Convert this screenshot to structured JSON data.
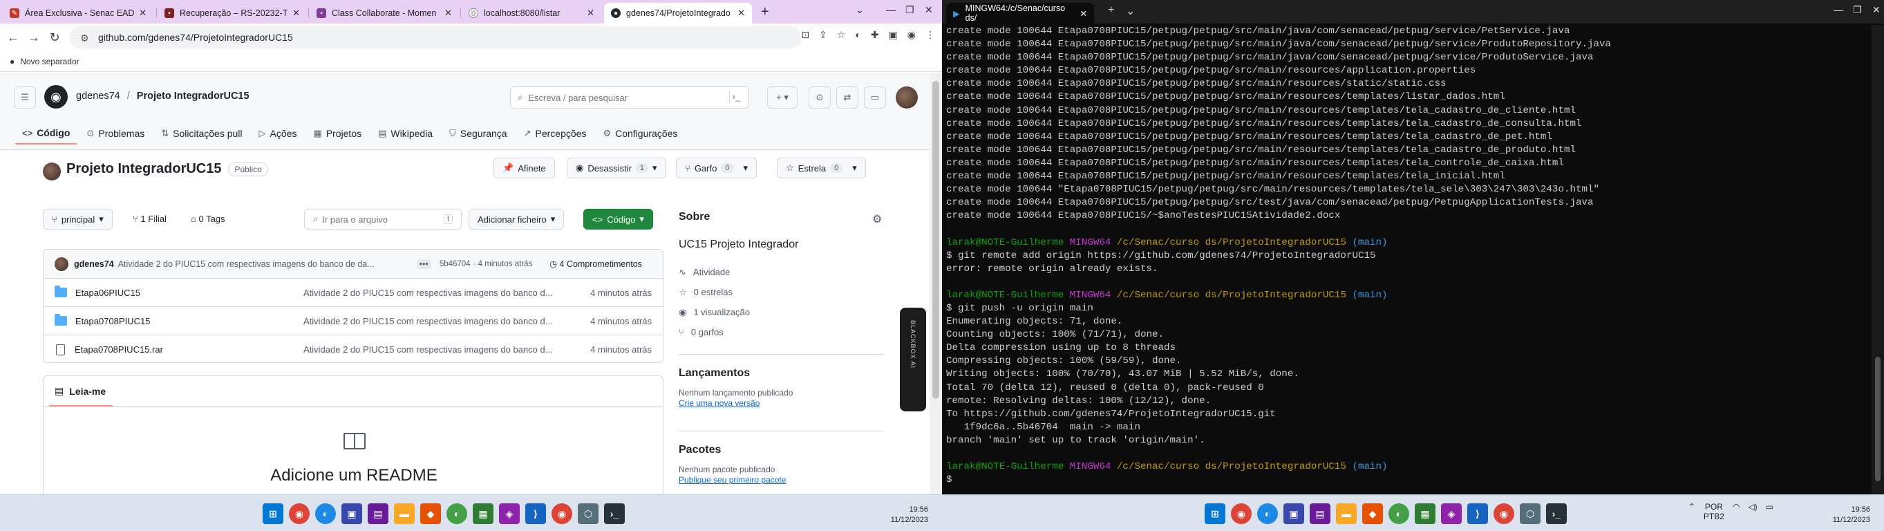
{
  "browser": {
    "tabs": [
      {
        "title": "Área Exclusiva - Senac EAD",
        "color": "#c0392b"
      },
      {
        "title": "Recuperação – RS-20232-TE",
        "color": "#7b1f1f"
      },
      {
        "title": "Class Collaborate - Momen",
        "color": "#7d3c98"
      },
      {
        "title": "localhost:8080/listar",
        "color": "#666666"
      },
      {
        "title": "gdenes74/ProjetoIntegrado",
        "color": "#24292f"
      }
    ],
    "url": "github.com/gdenes74/ProjetoIntegradorUC15",
    "bookmark": "Novo separador"
  },
  "github": {
    "owner": "gdenes74",
    "repo": "Projeto IntegradorUC15",
    "search_placeholder": "Escreva / para pesquisar",
    "nav": [
      "Código",
      "Problemas",
      "Solicitações pull",
      "Ações",
      "Projetos",
      "Wikipedia",
      "Segurança",
      "Percepções",
      "Configurações"
    ],
    "repo_title": "Projeto IntegradorUC15",
    "visibility": "Público",
    "pin": "Afinete",
    "unwatch": "Desassistir",
    "unwatch_count": "1",
    "fork": "Garfo",
    "fork_count": "0",
    "star": "Estrela",
    "star_count": "0",
    "branch": "principal",
    "branches": "1 Filial",
    "tags": "0 Tags",
    "goto_file": "Ir para o arquivo",
    "goto_key": "t",
    "add_file": "Adicionar ficheiro",
    "code_btn": "Código",
    "commit": {
      "author": "gdenes74",
      "message": "Atividade 2 do PIUC15 com respectivas imagens do banco de da...",
      "hash": "5b46704",
      "time": "· 4 minutos atrás",
      "commits": "4 Comprometimentos"
    },
    "files": [
      {
        "name": "Etapa06PIUC15",
        "type": "folder",
        "msg": "Atividade 2 do PIUC15 com respectivas imagens do banco d...",
        "time": "4 minutos atrás"
      },
      {
        "name": "Etapa0708PIUC15",
        "type": "folder",
        "msg": "Atividade 2 do PIUC15 com respectivas imagens do banco d...",
        "time": "4 minutos atrás"
      },
      {
        "name": "Etapa0708PIUC15.rar",
        "type": "file",
        "msg": "Atividade 2 do PIUC15 com respectivas imagens do banco d...",
        "time": "4 minutos atrás"
      }
    ],
    "readme_tab": "Leia-me",
    "readme_cta": "Adicione um README",
    "about": {
      "title": "Sobre",
      "desc": "UC15 Projeto Integrador",
      "stats": [
        "Atividade",
        "0 estrelas",
        "1 visualização",
        "0 garfos"
      ]
    },
    "releases": {
      "title": "Lançamentos",
      "text": "Nenhum lançamento publicado",
      "link": "Crie uma nova versão"
    },
    "packages": {
      "title": "Pacotes",
      "text": "Nenhum pacote publicado",
      "link": "Publique seu primeiro pacote"
    },
    "blackbox": "BLACKBOX AI"
  },
  "taskbar_left": {
    "time": "19:56",
    "date": "11/12/2023"
  },
  "taskbar_right": {
    "lang1": "POR",
    "lang2": "PTB2",
    "time": "19:56",
    "date": "11/12/2023"
  },
  "terminal": {
    "title": "MINGW64:/c/Senac/curso ds/",
    "create_lines": [
      "create mode 100644 Etapa0708PIUC15/petpug/petpug/src/main/java/com/senacead/petpug/service/PetService.java",
      "create mode 100644 Etapa0708PIUC15/petpug/petpug/src/main/java/com/senacead/petpug/service/ProdutoRepository.java",
      "create mode 100644 Etapa0708PIUC15/petpug/petpug/src/main/java/com/senacead/petpug/service/ProdutoService.java",
      "create mode 100644 Etapa0708PIUC15/petpug/petpug/src/main/resources/application.properties",
      "create mode 100644 Etapa0708PIUC15/petpug/petpug/src/main/resources/static/static.css",
      "create mode 100644 Etapa0708PIUC15/petpug/petpug/src/main/resources/templates/listar_dados.html",
      "create mode 100644 Etapa0708PIUC15/petpug/petpug/src/main/resources/templates/tela_cadastro_de_cliente.html",
      "create mode 100644 Etapa0708PIUC15/petpug/petpug/src/main/resources/templates/tela_cadastro_de_consulta.html",
      "create mode 100644 Etapa0708PIUC15/petpug/petpug/src/main/resources/templates/tela_cadastro_de_pet.html",
      "create mode 100644 Etapa0708PIUC15/petpug/petpug/src/main/resources/templates/tela_cadastro_de_produto.html",
      "create mode 100644 Etapa0708PIUC15/petpug/petpug/src/main/resources/templates/tela_controle_de_caixa.html",
      "create mode 100644 Etapa0708PIUC15/petpug/petpug/src/main/resources/templates/tela_inicial.html",
      "create mode 100644 \"Etapa0708PIUC15/petpug/petpug/src/main/resources/templates/tela_sele\\303\\247\\303\\243o.html\"",
      "create mode 100644 Etapa0708PIUC15/petpug/petpug/src/test/java/com/senacead/petpug/PetpugApplicationTests.java",
      "create mode 100644 Etapa0708PIUC15/~$anoTestesPIUC15Atividade2.docx"
    ],
    "prompt_user": "larak@NOTE-Guilherme",
    "prompt_env": "MINGW64",
    "prompt_path": "/c/Senac/curso ds/ProjetoIntegradorUC15",
    "prompt_branch": "(main)",
    "cmd1": "$ git remote add origin https://github.com/gdenes74/ProjetoIntegradorUC15",
    "out1": [
      "error: remote origin already exists."
    ],
    "cmd2": "$ git push -u origin main",
    "out2": [
      "Enumerating objects: 71, done.",
      "Counting objects: 100% (71/71), done.",
      "Delta compression using up to 8 threads",
      "Compressing objects: 100% (59/59), done.",
      "Writing objects: 100% (70/70), 43.07 MiB | 5.52 MiB/s, done.",
      "Total 70 (delta 12), reused 0 (delta 0), pack-reused 0",
      "remote: Resolving deltas: 100% (12/12), done.",
      "To https://github.com/gdenes74/ProjetoIntegradorUC15.git",
      "   1f9dc6a..5b46704  main -> main",
      "branch 'main' set up to track 'origin/main'."
    ],
    "last_prompt": "$"
  }
}
